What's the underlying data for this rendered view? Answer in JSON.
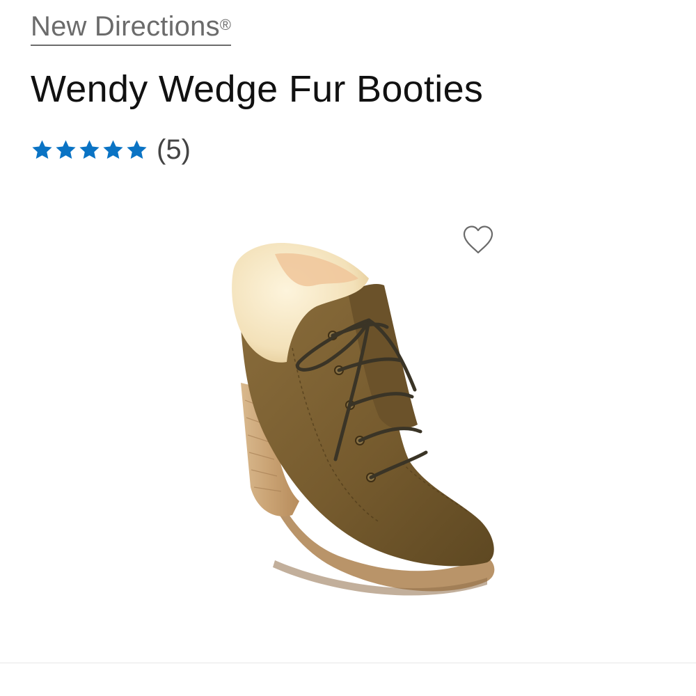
{
  "product": {
    "brand": "New Directions",
    "brand_mark": "®",
    "title": "Wendy Wedge Fur Booties",
    "rating": {
      "stars": 5,
      "max_stars": 5,
      "review_count": "(5)"
    }
  },
  "colors": {
    "star": "#0a73c4",
    "brand_link": "#6b6b6b",
    "title": "#111111"
  },
  "icons": {
    "star": "star-icon",
    "wishlist": "heart-outline-icon"
  }
}
